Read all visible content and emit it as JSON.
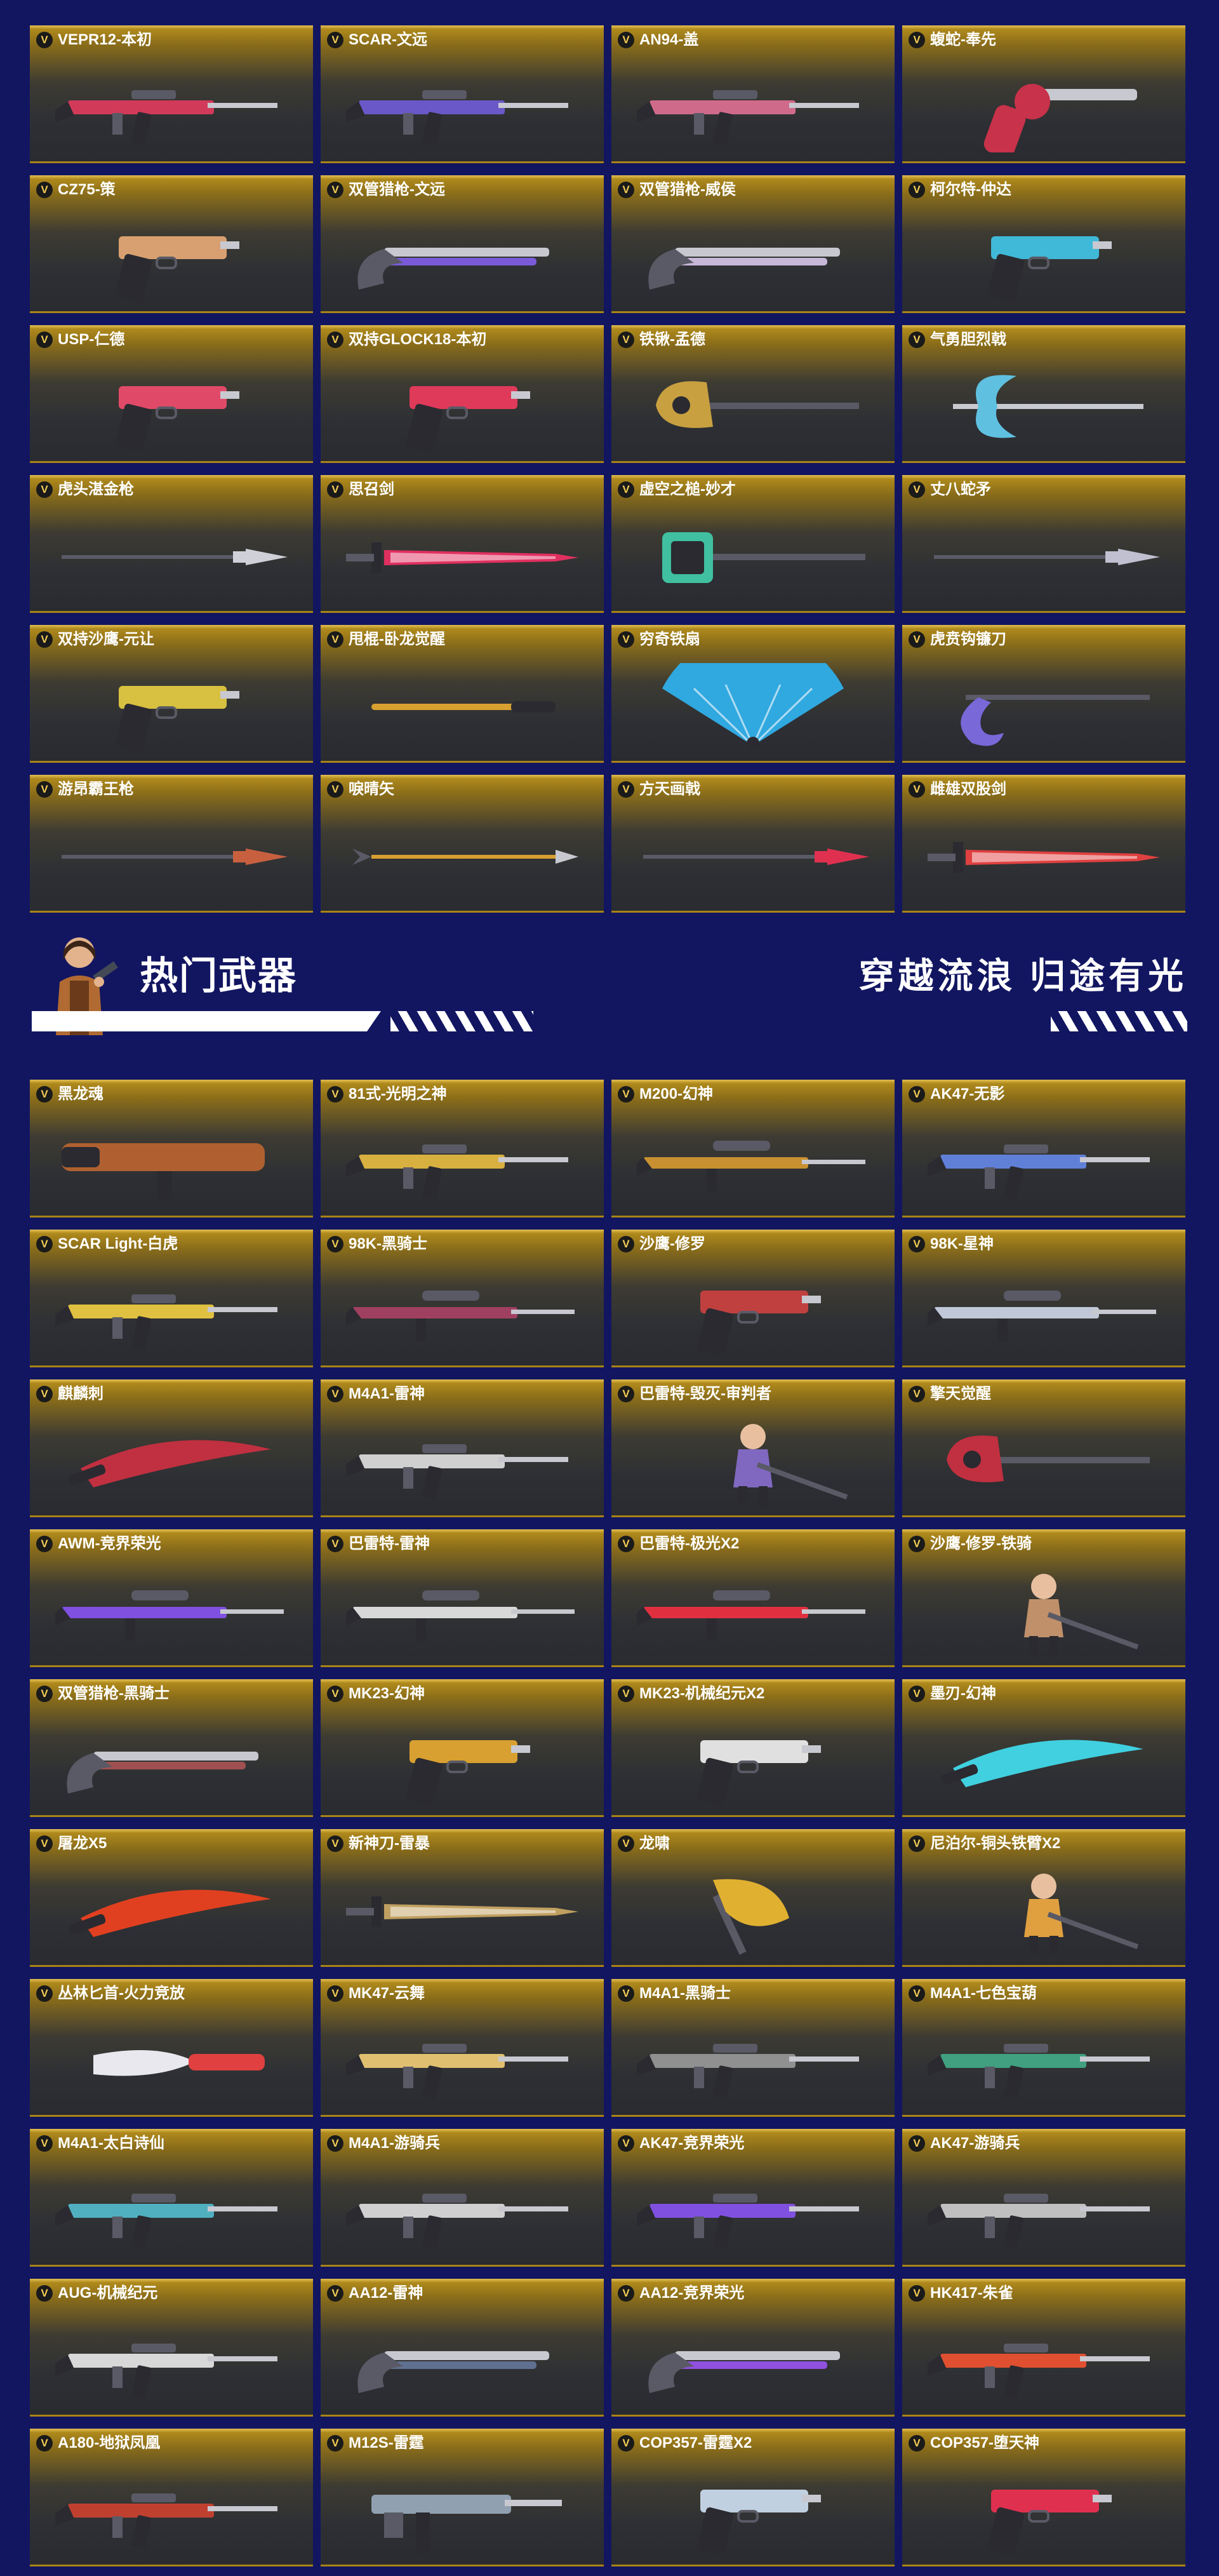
{
  "top_weapons": [
    {
      "badge": "V",
      "name": "VEPR12-本初",
      "icon": "rifle-icon",
      "color": "#d23a5a"
    },
    {
      "badge": "V",
      "name": "SCAR-文远",
      "icon": "rifle-icon",
      "color": "#6a58c8"
    },
    {
      "badge": "V",
      "name": "AN94-盖",
      "icon": "rifle-icon",
      "color": "#d06a8a"
    },
    {
      "badge": "V",
      "name": "蝮蛇-奉先",
      "icon": "revolver-icon",
      "color": "#c8324a"
    },
    {
      "badge": "V",
      "name": "CZ75-策",
      "icon": "pistol-icon",
      "color": "#d8a070"
    },
    {
      "badge": "V",
      "name": "双管猎枪-文远",
      "icon": "shotgun-icon",
      "color": "#7a5ad8"
    },
    {
      "badge": "V",
      "name": "双管猎枪-威侯",
      "icon": "shotgun-icon",
      "color": "#c8b8d8"
    },
    {
      "badge": "V",
      "name": "柯尔特-仲达",
      "icon": "pistol-icon",
      "color": "#40b8d8"
    },
    {
      "badge": "V",
      "name": "USP-仁德",
      "icon": "pistol-icon",
      "color": "#e04a68"
    },
    {
      "badge": "V",
      "name": "双持GLOCK18-本初",
      "icon": "pistol-icon",
      "color": "#e03a5a"
    },
    {
      "badge": "V",
      "name": "铁锹-孟德",
      "icon": "shovel-icon",
      "color": "#c8a040"
    },
    {
      "badge": "V",
      "name": "气勇胆烈戟",
      "icon": "halberd-icon",
      "color": "#60c0e0"
    },
    {
      "badge": "V",
      "name": "虎头湛金枪",
      "icon": "spear-icon",
      "color": "#d0d0d8"
    },
    {
      "badge": "V",
      "name": "思召剑",
      "icon": "sword-icon",
      "color": "#e03060"
    },
    {
      "badge": "V",
      "name": "虚空之槌-妙才",
      "icon": "hammer-icon",
      "color": "#40c0a0"
    },
    {
      "badge": "V",
      "name": "丈八蛇矛",
      "icon": "spear-icon",
      "color": "#c0c0d0"
    },
    {
      "badge": "V",
      "name": "双持沙鹰-元让",
      "icon": "pistol-icon",
      "color": "#d8c040"
    },
    {
      "badge": "V",
      "name": "甩棍-卧龙觉醒",
      "icon": "baton-icon",
      "color": "#d8a030"
    },
    {
      "badge": "V",
      "name": "穷奇铁扇",
      "icon": "fan-icon",
      "color": "#30a8e0"
    },
    {
      "badge": "V",
      "name": "虎贲钩镰刀",
      "icon": "hook-icon",
      "color": "#7868d8"
    },
    {
      "badge": "V",
      "name": "游昂霸王枪",
      "icon": "spear-icon",
      "color": "#c86040"
    },
    {
      "badge": "V",
      "name": "唳晴矢",
      "icon": "arrow-icon",
      "color": "#d8a030"
    },
    {
      "badge": "V",
      "name": "方天画戟",
      "icon": "spear-icon",
      "color": "#e03050"
    },
    {
      "badge": "V",
      "name": "雌雄双股剑",
      "icon": "sword-icon",
      "color": "#e04040"
    }
  ],
  "banner": {
    "title": "热门武器",
    "slogan": "穿越流浪 归途有光",
    "character_icon": "character-icon"
  },
  "hot_weapons": [
    {
      "badge": "V",
      "name": "黑龙魂",
      "icon": "launcher-icon",
      "color": "#b06030"
    },
    {
      "badge": "V",
      "name": "81式-光明之神",
      "icon": "rifle-icon",
      "color": "#d8b040"
    },
    {
      "badge": "V",
      "name": "M200-幻神",
      "icon": "sniper-icon",
      "color": "#c89030"
    },
    {
      "badge": "V",
      "name": "AK47-无影",
      "icon": "rifle-icon",
      "color": "#6080d8"
    },
    {
      "badge": "V",
      "name": "SCAR Light-白虎",
      "icon": "rifle-icon",
      "color": "#e0c040"
    },
    {
      "badge": "V",
      "name": "98K-黑骑士",
      "icon": "sniper-icon",
      "color": "#a04060"
    },
    {
      "badge": "V",
      "name": "沙鹰-修罗",
      "icon": "pistol-icon",
      "color": "#c04040"
    },
    {
      "badge": "V",
      "name": "98K-星神",
      "icon": "sniper-icon",
      "color": "#c0c8d8"
    },
    {
      "badge": "V",
      "name": "麒麟刺",
      "icon": "blade-icon",
      "color": "#c03040"
    },
    {
      "badge": "V",
      "name": "M4A1-雷神",
      "icon": "rifle-icon",
      "color": "#d0d0d0"
    },
    {
      "badge": "V",
      "name": "巴雷特-毁灭-审判者",
      "icon": "character-icon",
      "color": "#8068c0"
    },
    {
      "badge": "V",
      "name": "擎天觉醒",
      "icon": "shovel-icon",
      "color": "#c03040"
    },
    {
      "badge": "V",
      "name": "AWM-竞界荣光",
      "icon": "sniper-icon",
      "color": "#8050e0"
    },
    {
      "badge": "V",
      "name": "巴雷特-雷神",
      "icon": "sniper-icon",
      "color": "#d8d8d8"
    },
    {
      "badge": "V",
      "name": "巴雷特-极光X2",
      "icon": "sniper-icon",
      "color": "#e03040"
    },
    {
      "badge": "V",
      "name": "沙鹰-修罗-铁骑",
      "icon": "character-icon",
      "color": "#c0906a"
    },
    {
      "badge": "V",
      "name": "双管猎枪-黑骑士",
      "icon": "shotgun-icon",
      "color": "#a05050"
    },
    {
      "badge": "V",
      "name": "MK23-幻神",
      "icon": "pistol-icon",
      "color": "#d8a030"
    },
    {
      "badge": "V",
      "name": "MK23-机械纪元X2",
      "icon": "pistol-icon",
      "color": "#e0e0e0"
    },
    {
      "badge": "V",
      "name": "墨刃-幻神",
      "icon": "blade-icon",
      "color": "#40d0e0"
    },
    {
      "badge": "V",
      "name": "屠龙X5",
      "icon": "blade-icon",
      "color": "#e04020"
    },
    {
      "badge": "V",
      "name": "新神刀-雷暴",
      "icon": "sword-icon",
      "color": "#c0a060"
    },
    {
      "badge": "V",
      "name": "龙啸",
      "icon": "axe-icon",
      "color": "#e0b030"
    },
    {
      "badge": "V",
      "name": "尼泊尔-铜头铁臂X2",
      "icon": "character-icon",
      "color": "#e0a040"
    },
    {
      "badge": "V",
      "name": "丛林匕首-火力竞放",
      "icon": "knife-icon",
      "color": "#e04040"
    },
    {
      "badge": "V",
      "name": "MK47-云舞",
      "icon": "rifle-icon",
      "color": "#e0c070"
    },
    {
      "badge": "V",
      "name": "M4A1-黑骑士",
      "icon": "rifle-icon",
      "color": "#909090"
    },
    {
      "badge": "V",
      "name": "M4A1-七色宝葫",
      "icon": "rifle-icon",
      "color": "#40a080"
    },
    {
      "badge": "V",
      "name": "M4A1-太白诗仙",
      "icon": "rifle-icon",
      "color": "#50b0c0"
    },
    {
      "badge": "V",
      "name": "M4A1-游骑兵",
      "icon": "rifle-icon",
      "color": "#d0d0d0"
    },
    {
      "badge": "V",
      "name": "AK47-竞界荣光",
      "icon": "rifle-icon",
      "color": "#8050e0"
    },
    {
      "badge": "V",
      "name": "AK47-游骑兵",
      "icon": "rifle-icon",
      "color": "#c0c0c0"
    },
    {
      "badge": "V",
      "name": "AUG-机械纪元",
      "icon": "rifle-icon",
      "color": "#d8d8d8"
    },
    {
      "badge": "V",
      "name": "AA12-雷神",
      "icon": "shotgun-icon",
      "color": "#607090"
    },
    {
      "badge": "V",
      "name": "AA12-竞界荣光",
      "icon": "shotgun-icon",
      "color": "#9050e0"
    },
    {
      "badge": "V",
      "name": "HK417-朱雀",
      "icon": "rifle-icon",
      "color": "#e05030"
    },
    {
      "badge": "V",
      "name": "A180-地狱凤凰",
      "icon": "rifle-icon",
      "color": "#c04030"
    },
    {
      "badge": "V",
      "name": "M12S-雷霆",
      "icon": "smg-icon",
      "color": "#90a0b0"
    },
    {
      "badge": "V",
      "name": "COP357-雷霆X2",
      "icon": "pistol-icon",
      "color": "#c0d0e0"
    },
    {
      "badge": "V",
      "name": "COP357-堕天神",
      "icon": "pistol-icon",
      "color": "#e03050"
    }
  ]
}
